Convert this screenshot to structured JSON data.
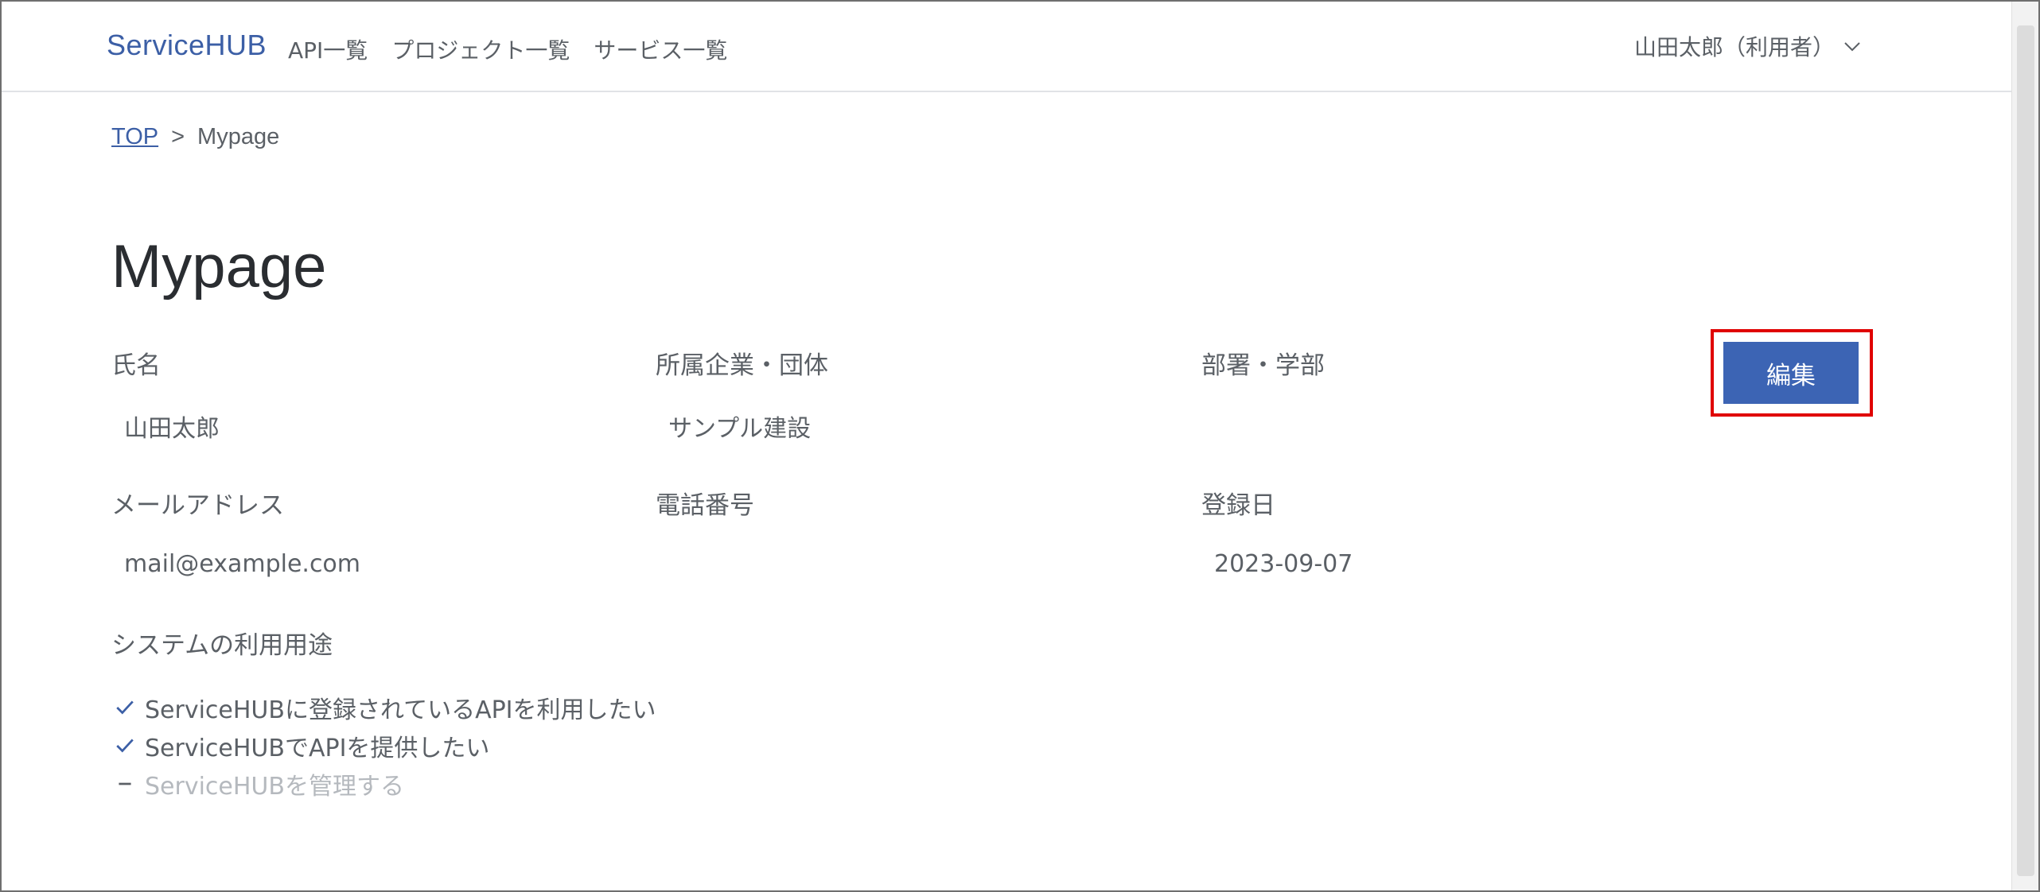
{
  "header": {
    "logo": "ServiceHUB",
    "nav": [
      {
        "label": "API一覧"
      },
      {
        "label": "プロジェクト一覧"
      },
      {
        "label": "サービス一覧"
      }
    ],
    "user": "山田太郎（利用者）",
    "user_icon": "chevron-down-icon"
  },
  "breadcrumb": {
    "home": "TOP",
    "separator": ">",
    "current": "Mypage"
  },
  "page": {
    "title": "Mypage",
    "edit_label": "編集"
  },
  "profile": {
    "name_label": "氏名",
    "name_value": "山田太郎",
    "company_label": "所属企業・団体",
    "company_value": "サンプル建設",
    "dept_label": "部署・学部",
    "dept_value": "",
    "email_label": "メールアドレス",
    "email_value": "mail@example.com",
    "phone_label": "電話番号",
    "phone_value": "",
    "registered_label": "登録日",
    "registered_value": "2023-09-07"
  },
  "usage": {
    "label": "システムの利用用途",
    "items": [
      {
        "text": "ServiceHUBに登録されているAPIを利用したい",
        "checked": true
      },
      {
        "text": "ServiceHUBでAPIを提供したい",
        "checked": true
      },
      {
        "text": "ServiceHUBを管理する",
        "checked": false
      }
    ]
  },
  "colors": {
    "accent": "#3c5fa6",
    "button": "#3c64b4",
    "highlight": "#e00000"
  }
}
